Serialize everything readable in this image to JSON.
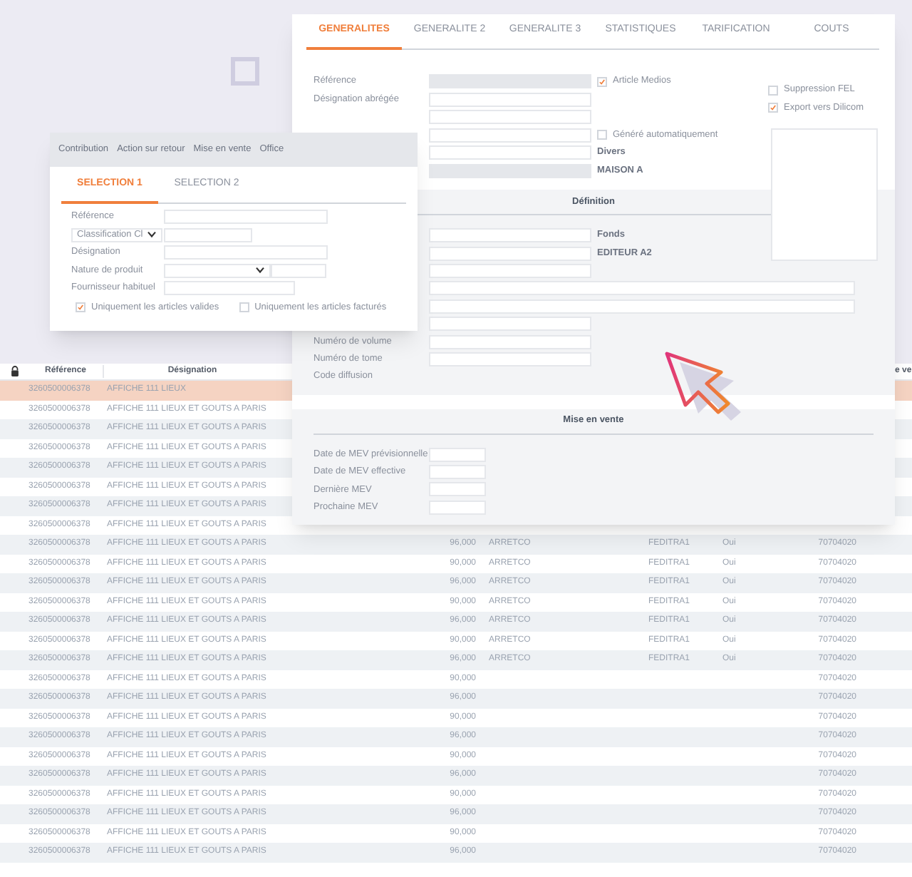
{
  "selection_window": {
    "menu": [
      "Contribution",
      "Action sur retour",
      "Mise en vente",
      "Office"
    ],
    "tabs": [
      {
        "label": "SELECTION 1",
        "selected": true
      },
      {
        "label": "SELECTION 2",
        "selected": false
      }
    ],
    "fields": [
      {
        "kind": "text",
        "label": "Référence"
      },
      {
        "kind": "select_text",
        "value": "Classification Cl"
      },
      {
        "kind": "text",
        "label": "Désignation"
      },
      {
        "kind": "dropdown_text",
        "label": "Nature de produit"
      },
      {
        "kind": "text",
        "label": "Fournisseur habituel"
      }
    ],
    "checkboxes": [
      {
        "label": "Uniquement les articles valides",
        "checked": true
      },
      {
        "label": "Uniquement les articles facturés",
        "checked": false
      }
    ]
  },
  "article_window": {
    "tabs": [
      {
        "label": "GENERALITES",
        "selected": true
      },
      {
        "label": "GENERALITE 2",
        "selected": false
      },
      {
        "label": "GENERALITE 3",
        "selected": false
      },
      {
        "label": "STATISTIQUES",
        "selected": false
      },
      {
        "label": "TARIFICATION",
        "selected": false
      },
      {
        "label": "COUTS",
        "selected": false
      }
    ],
    "general": [
      {
        "label": "Référence",
        "kind": "input",
        "readonly": true,
        "extra": {
          "kind": "checkbox",
          "label": "Article Medios",
          "checked": true
        }
      },
      {
        "label": "Désignation abrégée",
        "kind": "input",
        "readonly": false
      },
      {
        "kind": "input",
        "readonly": false
      },
      {
        "kind": "input",
        "readonly": false,
        "extra": {
          "kind": "checkbox",
          "label": "Généré automatiquement",
          "checked": false
        }
      },
      {
        "kind": "input",
        "readonly": false,
        "extra": {
          "kind": "text",
          "text": "Divers"
        }
      },
      {
        "kind": "input",
        "readonly": true,
        "extra": {
          "kind": "text",
          "text": "MAISON A"
        }
      }
    ],
    "side_checks": [
      {
        "label": "Suppression FEL",
        "checked": false
      },
      {
        "label": "Export vers Dilicom",
        "checked": true
      }
    ],
    "definition": {
      "title": "Définition",
      "rows": [
        {
          "kind": "input",
          "extra": {
            "kind": "text",
            "text": "Fonds"
          }
        },
        {
          "kind": "input",
          "extra": {
            "kind": "text",
            "text": "EDITEUR A2"
          }
        },
        {
          "kind": "input"
        },
        {
          "kind": "wide_input"
        },
        {
          "kind": "wide_input"
        },
        {
          "kind": "input"
        },
        {
          "label": "Numéro de volume",
          "kind": "input"
        },
        {
          "label": "Numéro de tome",
          "kind": "input"
        },
        {
          "label": "Code diffusion",
          "kind": "label"
        }
      ]
    },
    "mise_en_vente": {
      "title": "Mise en vente",
      "rows": [
        {
          "label": "Date de MEV prévisionnelle",
          "kind": "small_input"
        },
        {
          "label": "Date de MEV effective",
          "kind": "small_input"
        },
        {
          "label": "Dernière MEV",
          "kind": "small_input"
        },
        {
          "label": "Prochaine MEV",
          "kind": "small_input"
        }
      ]
    }
  },
  "table": {
    "columns": [
      "Référence",
      "Désignation",
      "e ve"
    ],
    "rows": [
      {
        "selected": true,
        "reference": "3260500006378",
        "designation": "AFFICHE 111 LIEUX"
      },
      {
        "selected": false,
        "reference": "3260500006378",
        "designation": "AFFICHE 111 LIEUX ET GOUTS A PARIS"
      },
      {
        "selected": false,
        "reference": "3260500006378",
        "designation": "AFFICHE 111 LIEUX ET GOUTS A PARIS"
      },
      {
        "selected": false,
        "reference": "3260500006378",
        "designation": "AFFICHE 111 LIEUX ET GOUTS A PARIS"
      },
      {
        "selected": false,
        "reference": "3260500006378",
        "designation": "AFFICHE 111 LIEUX ET GOUTS A PARIS"
      },
      {
        "selected": false,
        "reference": "3260500006378",
        "designation": "AFFICHE 111 LIEUX ET GOUTS A PARIS"
      },
      {
        "selected": false,
        "reference": "3260500006378",
        "designation": "AFFICHE 111 LIEUX ET GOUTS A PARIS"
      },
      {
        "selected": false,
        "reference": "3260500006378",
        "designation": "AFFICHE 111 LIEUX ET GOUTS A PARIS"
      },
      {
        "selected": false,
        "reference": "3260500006378",
        "designation": "AFFICHE 111 LIEUX ET GOUTS A PARIS",
        "price": "96,000",
        "supplier": "ARRETCO",
        "column_6": "FEDITRA1",
        "column_7": "Oui",
        "code": "70704020"
      },
      {
        "selected": false,
        "reference": "3260500006378",
        "designation": "AFFICHE 111 LIEUX ET GOUTS A PARIS",
        "price": "90,000",
        "supplier": "ARRETCO",
        "column_6": "FEDITRA1",
        "column_7": "Oui",
        "code": "70704020"
      },
      {
        "selected": false,
        "reference": "3260500006378",
        "designation": "AFFICHE 111 LIEUX ET GOUTS A PARIS",
        "price": "96,000",
        "supplier": "ARRETCO",
        "column_6": "FEDITRA1",
        "column_7": "Oui",
        "code": "70704020"
      },
      {
        "selected": false,
        "reference": "3260500006378",
        "designation": "AFFICHE 111 LIEUX ET GOUTS A PARIS",
        "price": "90,000",
        "supplier": "ARRETCO",
        "column_6": "FEDITRA1",
        "column_7": "Oui",
        "code": "70704020"
      },
      {
        "selected": false,
        "reference": "3260500006378",
        "designation": "AFFICHE 111 LIEUX ET GOUTS A PARIS",
        "price": "96,000",
        "supplier": "ARRETCO",
        "column_6": "FEDITRA1",
        "column_7": "Oui",
        "code": "70704020"
      },
      {
        "selected": false,
        "reference": "3260500006378",
        "designation": "AFFICHE 111 LIEUX ET GOUTS A PARIS",
        "price": "90,000",
        "supplier": "ARRETCO",
        "column_6": "FEDITRA1",
        "column_7": "Oui",
        "code": "70704020"
      },
      {
        "selected": false,
        "reference": "3260500006378",
        "designation": "AFFICHE 111 LIEUX ET GOUTS A PARIS",
        "price": "96,000",
        "supplier": "ARRETCO",
        "column_6": "FEDITRA1",
        "column_7": "Oui",
        "code": "70704020"
      },
      {
        "selected": false,
        "reference": "3260500006378",
        "designation": "AFFICHE 111 LIEUX ET GOUTS A PARIS",
        "price": "90,000",
        "code": "70704020"
      },
      {
        "selected": false,
        "reference": "3260500006378",
        "designation": "AFFICHE 111 LIEUX ET GOUTS A PARIS",
        "price": "96,000",
        "code": "70704020"
      },
      {
        "selected": false,
        "reference": "3260500006378",
        "designation": "AFFICHE 111 LIEUX ET GOUTS A PARIS",
        "price": "90,000",
        "code": "70704020"
      },
      {
        "selected": false,
        "reference": "3260500006378",
        "designation": "AFFICHE 111 LIEUX ET GOUTS A PARIS",
        "price": "96,000",
        "code": "70704020"
      },
      {
        "selected": false,
        "reference": "3260500006378",
        "designation": "AFFICHE 111 LIEUX ET GOUTS A PARIS",
        "price": "90,000",
        "code": "70704020"
      },
      {
        "selected": false,
        "reference": "3260500006378",
        "designation": "AFFICHE 111 LIEUX ET GOUTS A PARIS",
        "price": "96,000",
        "code": "70704020"
      },
      {
        "selected": false,
        "reference": "3260500006378",
        "designation": "AFFICHE 111 LIEUX ET GOUTS A PARIS",
        "price": "90,000",
        "code": "70704020"
      },
      {
        "selected": false,
        "reference": "3260500006378",
        "designation": "AFFICHE 111 LIEUX ET GOUTS A PARIS",
        "price": "96,000",
        "code": "70704020"
      },
      {
        "selected": false,
        "reference": "3260500006378",
        "designation": "AFFICHE 111 LIEUX ET GOUTS A PARIS",
        "price": "90,000",
        "code": "70704020"
      },
      {
        "selected": false,
        "reference": "3260500006378",
        "designation": "AFFICHE 111 LIEUX ET GOUTS A PARIS",
        "price": "96,000",
        "code": "70704020"
      }
    ]
  }
}
